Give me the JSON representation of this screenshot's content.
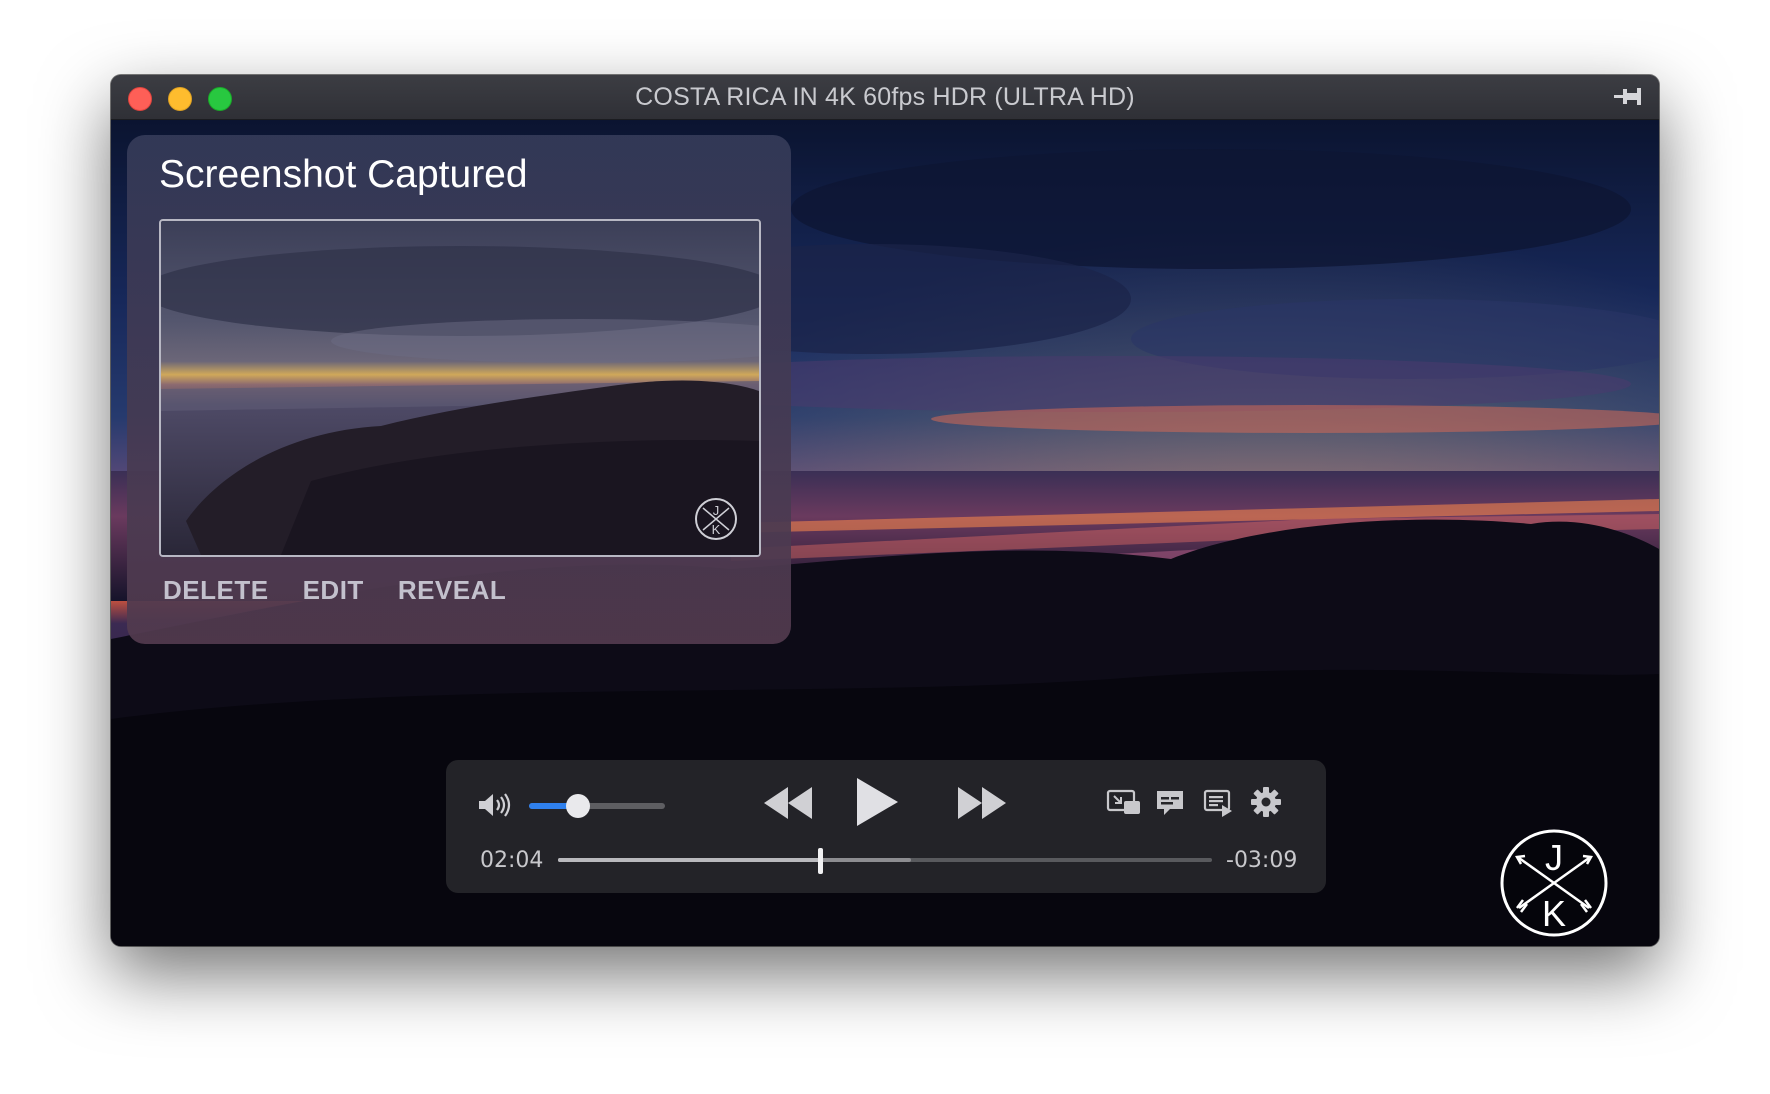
{
  "window": {
    "title": "COSTA RICA IN 4K 60fps HDR (ULTRA HD)"
  },
  "icons": {
    "close": "close-button-red",
    "minimize": "minimize-button-yellow",
    "maximize": "zoom-button-green",
    "pin": "pin-icon",
    "volume": "speaker-volume-icon",
    "rewind": "rewind-icon",
    "play": "play-icon",
    "forward": "fast-forward-icon",
    "pip": "picture-in-picture-icon",
    "subtitles": "subtitles-icon",
    "playlist": "playlist-icon",
    "settings": "gear-icon",
    "logo": "jk-crossed-arrows-logo"
  },
  "toast": {
    "title": "Screenshot Captured",
    "actions": {
      "delete": "DELETE",
      "edit": "EDIT",
      "reveal": "REVEAL"
    }
  },
  "player": {
    "elapsed": "02:04",
    "remaining": "-03:09",
    "volume_percent": 36,
    "progress_percent": 40,
    "buffered_percent": 54
  },
  "logo": {
    "top_letter": "J",
    "bottom_letter": "K"
  },
  "colors": {
    "accent": "#2f80ed",
    "close": "#fe5f57",
    "minimize": "#febc2e",
    "maximize": "#28c840"
  }
}
